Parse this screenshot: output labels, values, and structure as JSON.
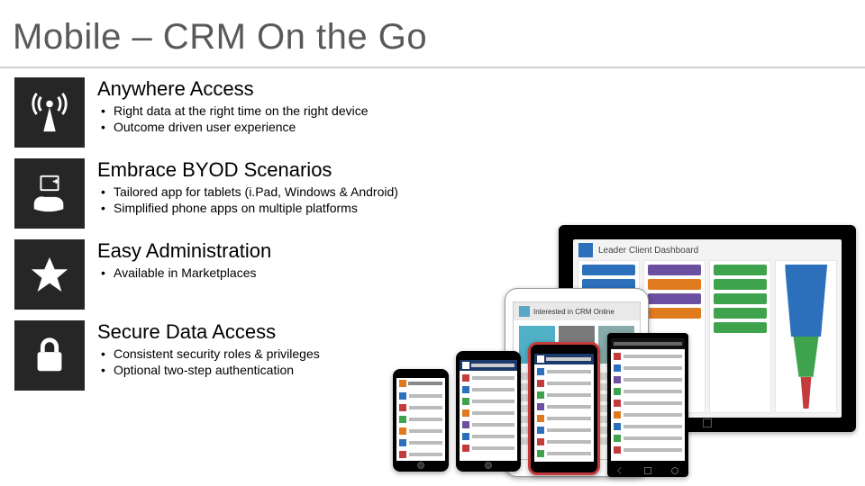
{
  "title": "Mobile – CRM On the Go",
  "sections": [
    {
      "icon": "antenna-icon",
      "heading": "Anywhere Access",
      "bullets": [
        "Right data at the right time on the right device",
        "Outcome driven user experience"
      ]
    },
    {
      "icon": "hand-device-icon",
      "heading": "Embrace BYOD Scenarios",
      "bullets": [
        "Tailored app for tablets (i.Pad, Windows & Android)",
        "Simplified phone apps on multiple platforms"
      ]
    },
    {
      "icon": "star-icon",
      "heading": "Easy Administration",
      "bullets": [
        "Available in Marketplaces"
      ]
    },
    {
      "icon": "lock-icon",
      "heading": "Secure Data Access",
      "bullets": [
        "Consistent security roles & privileges",
        "Optional two-step authentication"
      ]
    }
  ],
  "device_labels": {
    "tablet_title": "Leader Client Dashboard",
    "ipad_title": "Interested in CRM Online"
  }
}
